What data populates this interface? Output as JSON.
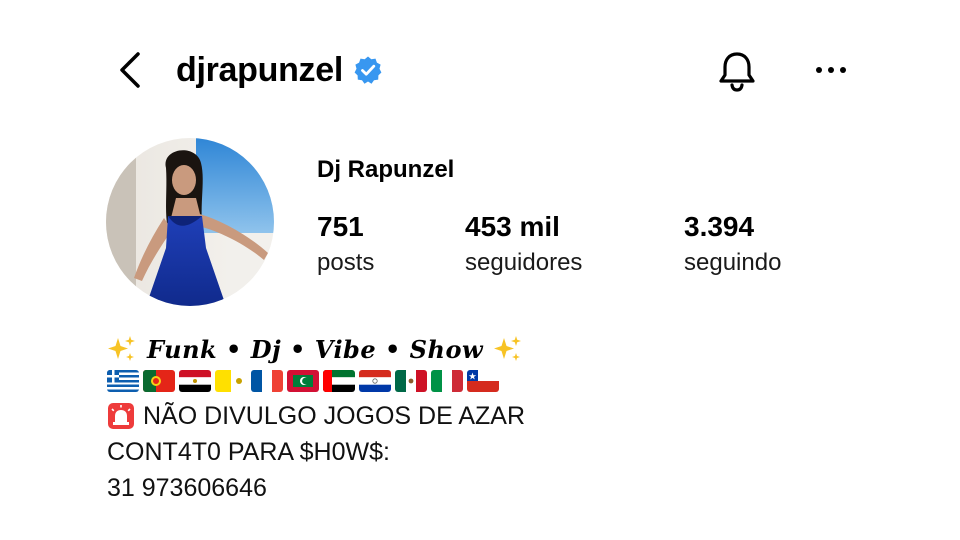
{
  "header": {
    "username": "djrapunzel",
    "verified": true,
    "icons": [
      "back-chevron-icon",
      "verified-badge-icon",
      "bell-icon",
      "more-horizontal-icon"
    ]
  },
  "profile": {
    "display_name": "Dj Rapunzel",
    "stats": [
      {
        "value": "751",
        "label": "posts"
      },
      {
        "value": "453 mil",
        "label": "seguidores"
      },
      {
        "value": "3.394",
        "label": "seguindo"
      }
    ]
  },
  "bio": {
    "tagline": "Funk • Dj • Vibe • Show",
    "flags": [
      "greece",
      "portugal",
      "egypt",
      "vatican",
      "france",
      "maldives",
      "uae",
      "paraguay",
      "mexico",
      "italy",
      "chile"
    ],
    "line1": "NÃO DIVULGO JOGOS DE AZAR",
    "line2": "CONT4T0 PARA $H0W$:",
    "line3": "31 973606646"
  },
  "colors": {
    "verified_blue": "#3897f0",
    "text": "#000000",
    "background": "#ffffff"
  }
}
